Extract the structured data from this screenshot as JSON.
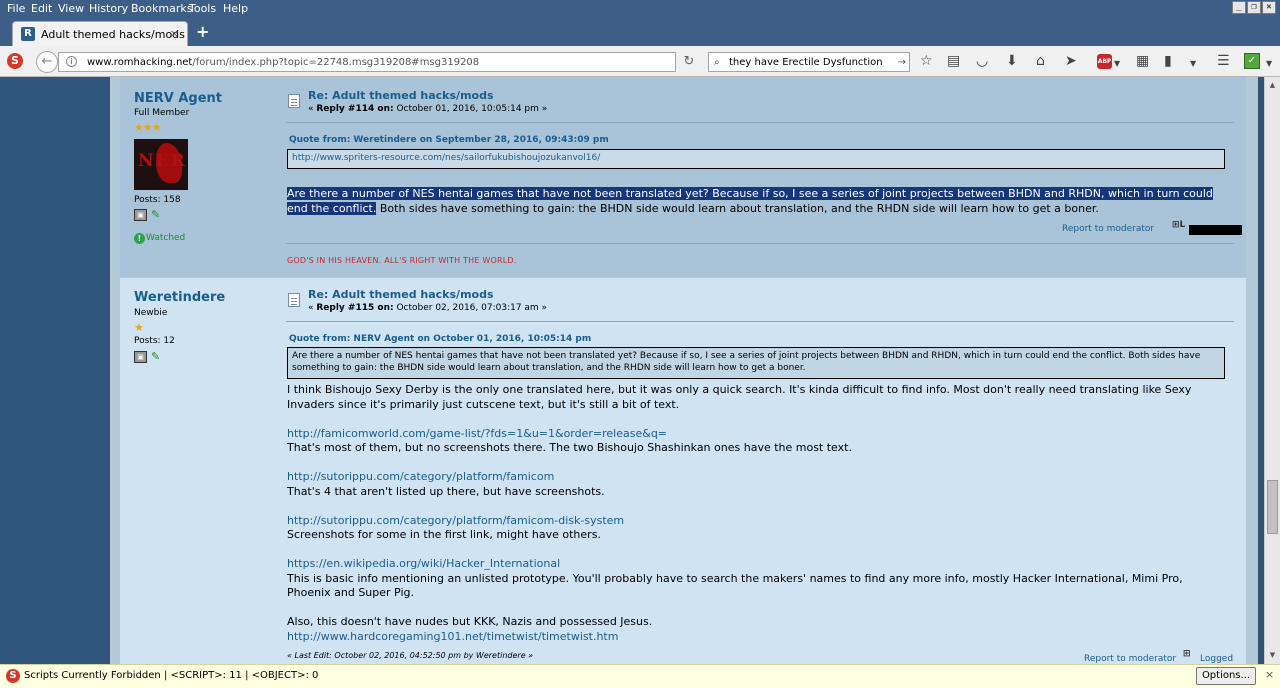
{
  "menu": [
    "File",
    "Edit",
    "View",
    "History",
    "Bookmarks",
    "Tools",
    "Help"
  ],
  "tab": {
    "favicon": "R",
    "title": "Adult themed hacks/mods",
    "close": "×",
    "new_tab": "+"
  },
  "nav": {
    "url_host": "www.romhacking.net",
    "url_path": "/forum/index.php?topic=22748.msg319208#msg319208",
    "search_value": "they have Erectile Dysfunction",
    "noscript_icon": "S",
    "back_icon": "←",
    "reload_icon": "↻",
    "go_icon": "→",
    "abp_label": "ABP"
  },
  "posts": [
    {
      "author": "NERV Agent",
      "rank": "Full Member",
      "stars": "★★★",
      "posts": "Posts: 158",
      "avatar_text": "NER",
      "subject": "Re: Adult themed hacks/mods",
      "reply_prefix": "« ",
      "reply_num": "Reply #114 on:",
      "reply_date": " October 01, 2016, 10:05:14 pm »",
      "quote_header": "Quote from: Weretindere on September 28, 2016, 09:43:09 pm",
      "quote_text": "http://www.spriters-resource.com/nes/sailorfukubishoujozukanvol16/",
      "body_selected": "Are there a number of NES hentai games that have not been translated yet? Because if so, I see a series of joint projects between BHDN and RHDN, which in turn could end the conflict.",
      "body_rest": " Both sides have something to gain: the BHDN side would learn about translation, and the RHDN side will learn how to get a boner.",
      "report": "Report to moderator",
      "watched": "Watched",
      "signature": "GOD'S IN HIS HEAVEN. ALL'S RIGHT WITH THE WORLD."
    },
    {
      "author": "Weretindere",
      "rank": "Newbie",
      "stars": "★",
      "posts": "Posts: 12",
      "subject": "Re: Adult themed hacks/mods",
      "reply_prefix": "« ",
      "reply_num": "Reply #115 on:",
      "reply_date": " October 02, 2016, 07:03:17 am »",
      "quote_header": "Quote from: NERV Agent on October 01, 2016, 10:05:14 pm",
      "quote_text": "Are there a number of NES hentai games that have not been translated yet? Because if so, I see a series of joint projects between BHDN and RHDN, which in turn could end the conflict. Both sides have something to gain: the BHDN side would learn about translation, and the RHDN side will learn how to get a boner.",
      "p1": "I think Bishoujo Sexy Derby is the only one translated here, but it was only a quick search. It's kinda difficult to find info. Most don't really need translating like Sexy Invaders since it's primarily just cutscene text, but it's still a bit of text.",
      "link1": "http://famicomworld.com/game-list/?fds=1&u=1&order=release&q=",
      "p2": "That's most of them, but no screenshots there. The two Bishoujo Shashinkan ones have the most text.",
      "link2": "http://sutorippu.com/category/platform/famicom",
      "p3": "That's 4 that aren't listed up there, but have screenshots.",
      "link3": "http://sutorippu.com/category/platform/famicom-disk-system",
      "p4": "Screenshots for some in the first link, might have others.",
      "link4": "https://en.wikipedia.org/wiki/Hacker_International",
      "p5": "This is basic info mentioning an unlisted prototype. You'll probably have to search the makers' names to find any more info, mostly Hacker International, Mimi Pro, Phoenix and Super Pig.",
      "p6": "Also, this doesn't have nudes but KKK, Nazis and possessed Jesus.",
      "link5": "http://www.hardcoregaming101.net/timetwist/timetwist.htm",
      "last_edit": "« Last Edit: October 02, 2016, 04:52:50 pm by Weretindere »",
      "report": "Report to moderator",
      "logged": "Logged"
    }
  ],
  "statusbar": {
    "message": "Scripts Currently Forbidden | <SCRIPT>: 11 | <OBJECT>: 0",
    "options": "Options...",
    "close": "×"
  }
}
